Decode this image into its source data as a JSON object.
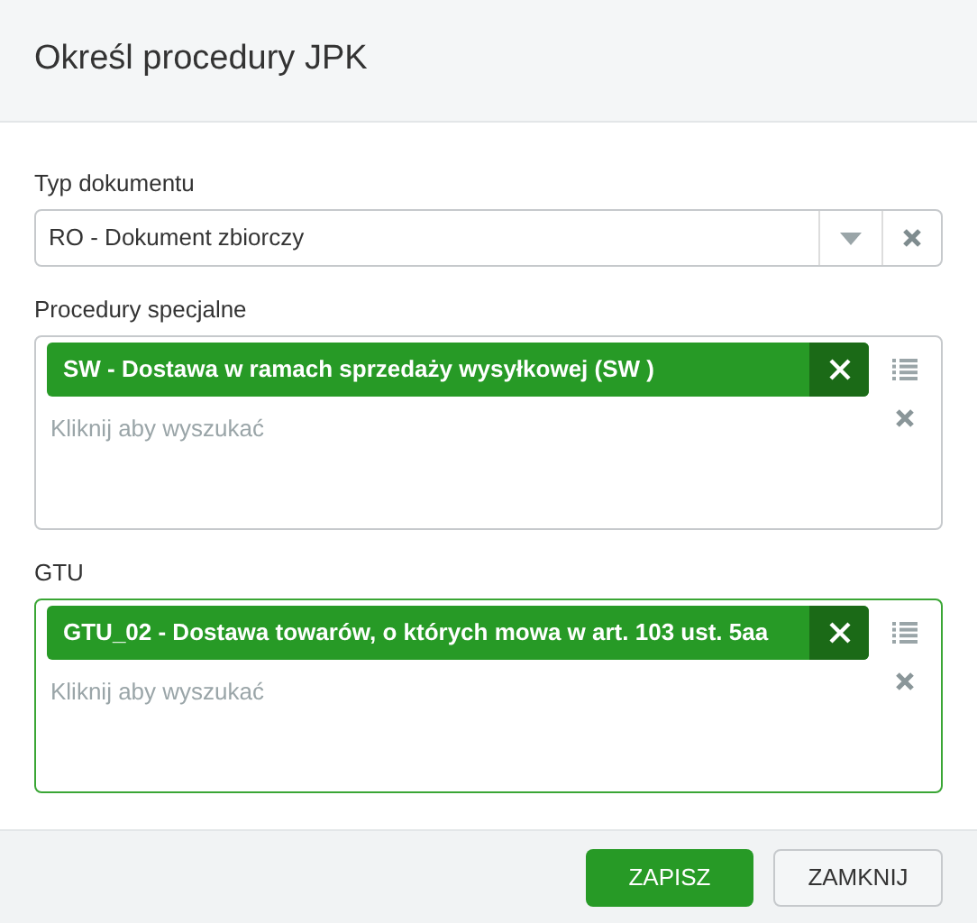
{
  "dialog": {
    "title": "Określ procedury JPK"
  },
  "document_type": {
    "label": "Typ dokumentu",
    "value": "RO - Dokument zbiorczy"
  },
  "multiselects": [
    {
      "label": "Procedury specjalne",
      "focused": false,
      "tags": [
        "SW - Dostawa w ramach sprzedaży wysyłkowej (SW )"
      ],
      "placeholder": "Kliknij aby wyszukać"
    },
    {
      "label": "GTU",
      "focused": true,
      "tags": [
        "GTU_02 - Dostawa towarów, o których mowa w art. 103 ust. 5aa"
      ],
      "placeholder": "Kliknij aby wyszukać"
    }
  ],
  "buttons": [
    {
      "label": "ZAPISZ",
      "kind": "primary"
    },
    {
      "label": "ZAMKNIJ",
      "kind": "secondary"
    }
  ]
}
